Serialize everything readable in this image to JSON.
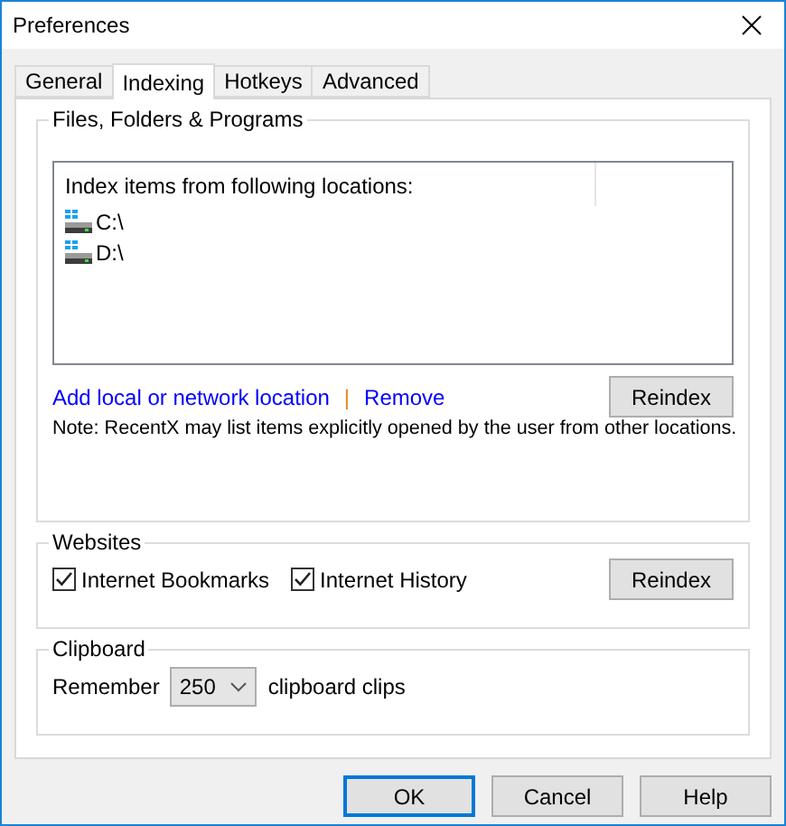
{
  "window": {
    "title": "Preferences"
  },
  "tabs": [
    {
      "label": "General",
      "selected": false
    },
    {
      "label": "Indexing",
      "selected": true
    },
    {
      "label": "Hotkeys",
      "selected": false
    },
    {
      "label": "Advanced",
      "selected": false
    }
  ],
  "files_group": {
    "title": "Files, Folders & Programs",
    "list": {
      "header": "Index items from following locations:",
      "items": [
        {
          "label": "C:\\"
        },
        {
          "label": "D:\\"
        }
      ]
    },
    "links": [
      "Add local or network location",
      "Remove"
    ],
    "separator": "|",
    "reindex": "Reindex",
    "note": "Note: RecentX may list items explicitly opened by the user from other locations."
  },
  "websites_group": {
    "title": "Websites",
    "options": [
      {
        "label": "Internet Bookmarks",
        "checked": true
      },
      {
        "label": "Internet History",
        "checked": true
      }
    ],
    "reindex": "Reindex"
  },
  "clipboard_group": {
    "title": "Clipboard",
    "prefix": "Remember",
    "value": "250",
    "suffix": "clipboard clips"
  },
  "buttons": [
    {
      "label": "OK",
      "default": true
    },
    {
      "label": "Cancel",
      "default": false
    },
    {
      "label": "Help",
      "default": false
    }
  ]
}
